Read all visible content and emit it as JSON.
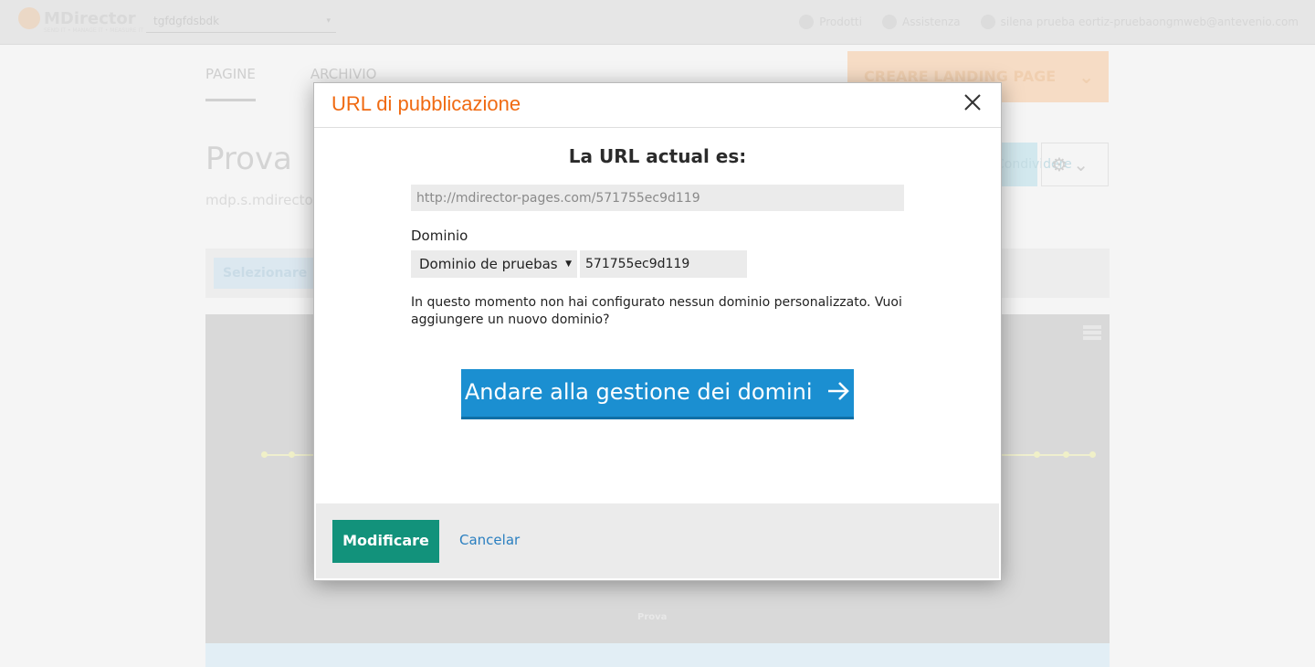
{
  "app": {
    "logo_text": "MDirector",
    "logo_subtitle": "SEND IT • MANAGE IT • MEASURE IT",
    "account": "tgfdgfdsbdk",
    "top_links": [
      "Prodotti",
      "Assistenza"
    ],
    "user": "silena prueba eortiz-pruebaongmweb@antevenio.com"
  },
  "nav": {
    "tabs": [
      "PAGINE",
      "ARCHIVIO"
    ],
    "create_button": "CREARE LANDING PAGE"
  },
  "page": {
    "title": "Prova",
    "subtitle": "mdp.s.mdirector",
    "share_button": "Condividere",
    "select_label": "Selezionare",
    "legend": "Prova"
  },
  "modal": {
    "title": "URL di pubblicazione",
    "heading": "La URL actual es:",
    "current_url": "http://mdirector-pages.com/571755ec9d119",
    "domain_label": "Dominio",
    "domain_select_value": "Dominio de pruebas",
    "subdomain_value": "571755ec9d119",
    "info_text": "In questo momento non hai configurato nessun dominio personalizzato. Vuoi aggiungere un nuovo dominio?",
    "go_button": "Andare alla gestione dei domini",
    "modify_button": "Modificare",
    "cancel_link": "Cancelar"
  },
  "colors": {
    "title_orange": "#f06a12",
    "primary_blue": "#1b8fd1",
    "modify_green": "#12927b",
    "link_blue": "#2a7fc0"
  },
  "icons": [
    "close-icon",
    "arrow-right-icon",
    "gear-icon",
    "chevron-down-icon",
    "user-icon",
    "help-icon",
    "grid-icon",
    "hamburger-menu-icon"
  ]
}
